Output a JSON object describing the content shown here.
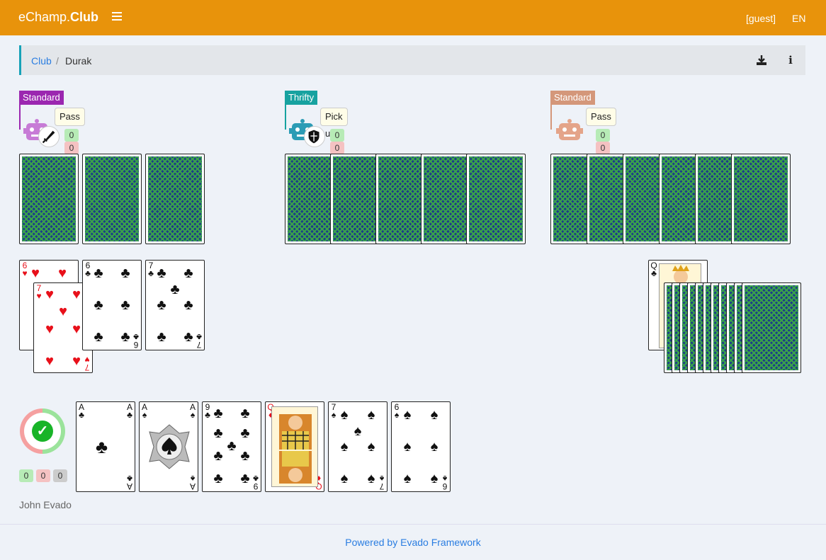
{
  "header": {
    "brand_left": "eChamp.",
    "brand_right": "Club",
    "user": "[guest]",
    "lang": "EN"
  },
  "breadcrumb": {
    "club": "Club",
    "sep": "/",
    "current": "Durak"
  },
  "icons": {
    "download": "download-icon",
    "info": "info-icon",
    "menu": "hamburger-icon"
  },
  "players": [
    {
      "tag": "Standard",
      "tag_color": "#9b27b0",
      "bot_color": "#c77bd6",
      "badge": "sword-icon",
      "action": "Pass",
      "scores": [
        "0",
        "0",
        "0"
      ]
    },
    {
      "tag": "Thrifty",
      "tag_color": "#17a2a0",
      "bot_color": "#2c9cb5",
      "badge": "shield-icon",
      "action": "Pick up",
      "scores": [
        "0",
        "0",
        "0"
      ]
    },
    {
      "tag": "Standard",
      "tag_color": "#d4977a",
      "bot_color": "#e4a489",
      "badge": "",
      "action": "Pass",
      "scores": [
        "0",
        "0",
        "0"
      ]
    }
  ],
  "table_cards": [
    {
      "rank": "6",
      "suit": "♥",
      "color": "red"
    },
    {
      "rank": "7",
      "suit": "♥",
      "color": "red"
    },
    {
      "rank": "6",
      "suit": "♣",
      "color": "blk"
    },
    {
      "rank": "7",
      "suit": "♣",
      "color": "blk"
    }
  ],
  "trump": {
    "rank": "Q",
    "suit": "♣"
  },
  "hand": [
    {
      "rank": "A",
      "suit": "♣",
      "color": "blk"
    },
    {
      "rank": "A",
      "suit": "♠",
      "color": "blk"
    },
    {
      "rank": "9",
      "suit": "♣",
      "color": "blk"
    },
    {
      "rank": "Q",
      "suit": "♦",
      "color": "red"
    },
    {
      "rank": "7",
      "suit": "♠",
      "color": "blk"
    },
    {
      "rank": "6",
      "suit": "♠",
      "color": "blk"
    }
  ],
  "me": {
    "name": "John Evado",
    "scores": [
      "0",
      "0",
      "0"
    ]
  },
  "footer": "Powered by Evado Framework"
}
